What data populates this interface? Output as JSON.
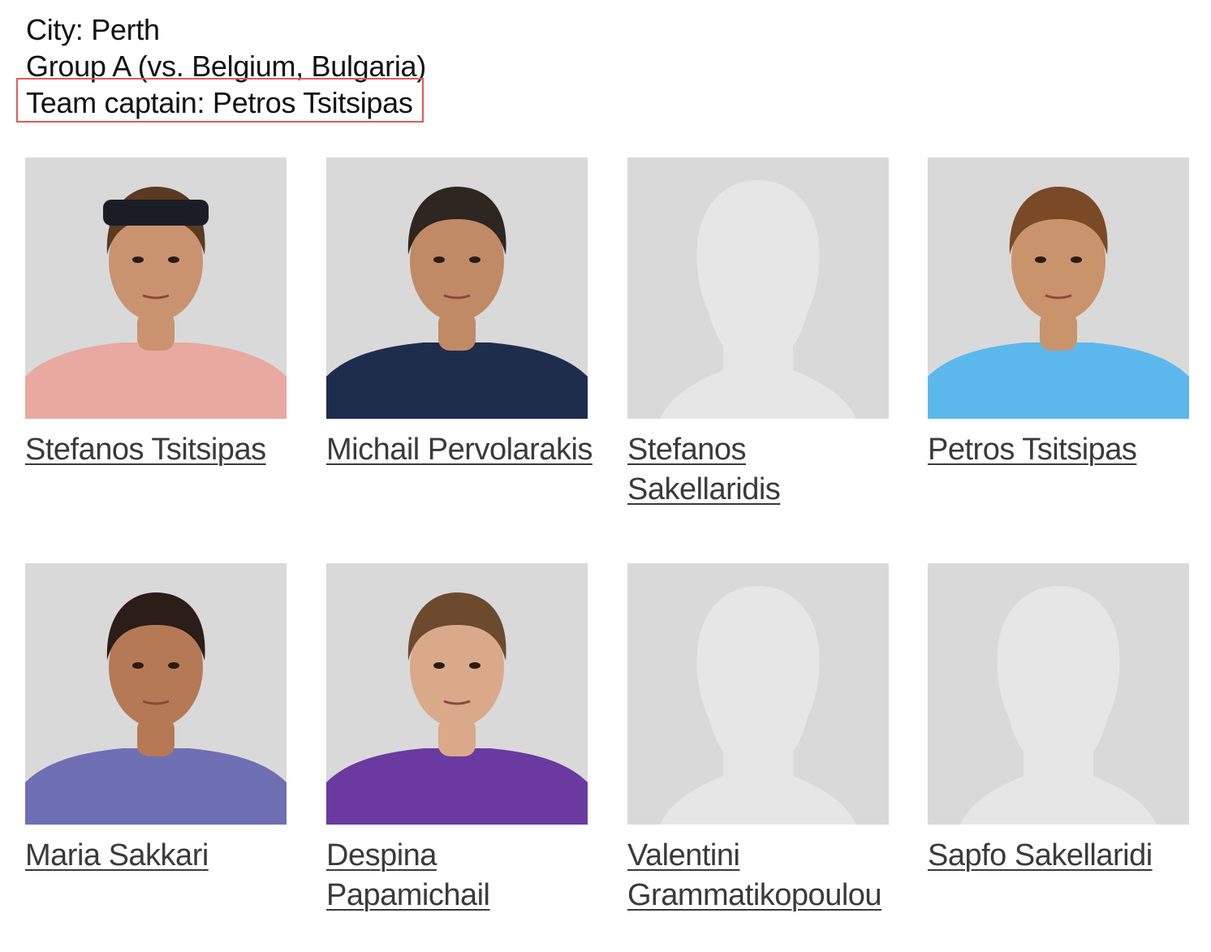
{
  "info": {
    "city": "City: Perth",
    "group": "Group A (vs. Belgium, Bulgaria)",
    "captain": "Team captain: Petros Tsitsipas"
  },
  "players": [
    {
      "name": "Stefanos Tsitsipas",
      "photo": "player-photo",
      "skin": "#c9936f",
      "hair": "#5a3a22",
      "shirt": "#e7a9a0"
    },
    {
      "name": "Michail Pervolarakis",
      "photo": "player-photo",
      "skin": "#c08a66",
      "hair": "#2e2620",
      "shirt": "#1f2d4d"
    },
    {
      "name": "Stefanos Sakellaridis",
      "photo": "placeholder-silhouette"
    },
    {
      "name": "Petros Tsitsipas",
      "photo": "player-photo",
      "skin": "#c9946c",
      "hair": "#7a4a26",
      "shirt": "#5cb8ec"
    },
    {
      "name": "Maria Sakkari",
      "photo": "player-photo",
      "skin": "#b57a55",
      "hair": "#2b1d17",
      "shirt": "#6f6fb3"
    },
    {
      "name": "Despina Papamichail",
      "photo": "player-photo",
      "skin": "#d9a98a",
      "hair": "#6b4a2e",
      "shirt": "#6a3aa0"
    },
    {
      "name": "Valentini Grammatikopoulou",
      "photo": "placeholder-silhouette"
    },
    {
      "name": "Sapfo Sakellaridi",
      "photo": "placeholder-silhouette"
    }
  ]
}
